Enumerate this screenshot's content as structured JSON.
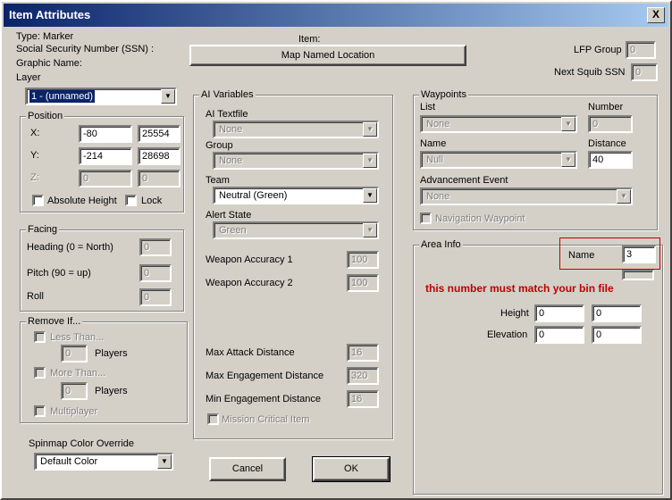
{
  "window": {
    "title": "Item Attributes",
    "close_glyph": "X"
  },
  "header": {
    "type": "Type: Marker",
    "ssn": "Social Security Number (SSN) :",
    "graphic_name": "Graphic Name:",
    "layer_label": "Layer",
    "layer_value": "1 - (unnamed)",
    "item_label": "Item:",
    "item_button": "Map Named Location",
    "lfp_group_label": "LFP Group",
    "lfp_group_value": "0",
    "next_squib_label": "Next Squib SSN",
    "next_squib_value": "0"
  },
  "position": {
    "title": "Position",
    "x_label": "X:",
    "x1": "-80",
    "x2": "25554",
    "y_label": "Y:",
    "y1": "-214",
    "y2": "28698",
    "z_label": "Z:",
    "z1": "0",
    "z2": "0",
    "absolute_height": "Absolute Height",
    "lock": "Lock"
  },
  "facing": {
    "title": "Facing",
    "heading_label": "Heading (0 = North)",
    "heading": "0",
    "pitch_label": "Pitch (90 = up)",
    "pitch": "0",
    "roll_label": "Roll",
    "roll": "0"
  },
  "remove_if": {
    "title": "Remove If...",
    "less_than": "Less Than...",
    "less_players_value": "0",
    "less_players_label": "Players",
    "more_than": "More Than...",
    "more_players_value": "0",
    "more_players_label": "Players",
    "multiplayer": "Multiplayer"
  },
  "spinmap": {
    "label": "Spinmap Color Override",
    "value": "Default Color"
  },
  "ai": {
    "title": "AI Variables",
    "textfile_label": "AI Textfile",
    "textfile_value": "None",
    "group_label": "Group",
    "group_value": "None",
    "team_label": "Team",
    "team_value": "Neutral (Green)",
    "alert_label": "Alert State",
    "alert_value": "Green",
    "weapon1_label": "Weapon Accuracy 1",
    "weapon1": "100",
    "weapon2_label": "Weapon Accuracy 2",
    "weapon2": "100",
    "max_attack_label": "Max Attack Distance",
    "max_attack": "16",
    "max_engage_label": "Max Engagement Distance",
    "max_engage": "320",
    "min_engage_label": "Min Engagement Distance",
    "min_engage": "16",
    "mission_critical": "Mission Critical Item"
  },
  "waypoints": {
    "title": "Waypoints",
    "list_label": "List",
    "list_value": "None",
    "number_label": "Number",
    "number_value": "0",
    "name_label": "Name",
    "name_value": "Null",
    "distance_label": "Distance",
    "distance_value": "40",
    "advancement_label": "Advancement Event",
    "advancement_value": "None",
    "navigation": "Navigation Waypoint"
  },
  "area": {
    "title": "Area Info",
    "name_label": "Name",
    "name_value": "3",
    "note": "this number must match your bin file",
    "height_label": "Height",
    "height1": "0",
    "height2": "0",
    "elevation_label": "Elevation",
    "elevation1": "0",
    "elevation2": "0"
  },
  "buttons": {
    "cancel": "Cancel",
    "ok": "OK"
  },
  "colors": {
    "titlebar_start": "#0a246a",
    "titlebar_end": "#a6caf0",
    "annotation": "#c00000",
    "face": "#d4d0c8"
  }
}
